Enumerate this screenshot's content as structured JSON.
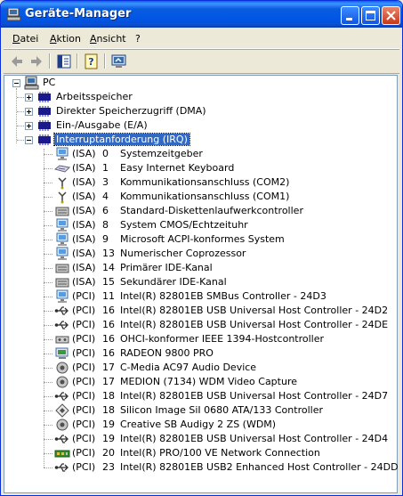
{
  "window": {
    "title": "Geräte-Manager"
  },
  "menu": [
    "Datei",
    "Aktion",
    "Ansicht",
    "?"
  ],
  "tree": {
    "root": "PC",
    "categories": [
      {
        "label": "Arbeitsspeicher",
        "expanded": false
      },
      {
        "label": "Direkter Speicherzugriff (DMA)",
        "expanded": false
      },
      {
        "label": "Ein-/Ausgabe (E/A)",
        "expanded": false
      },
      {
        "label": "Interruptanforderung (IRQ)",
        "expanded": true,
        "selected": true
      }
    ],
    "irq_items": [
      {
        "bus": "(ISA)",
        "irq": "0",
        "desc": "Systemzeitgeber",
        "icon": "monitor-icon"
      },
      {
        "bus": "(ISA)",
        "irq": "1",
        "desc": "Easy Internet Keyboard",
        "icon": "keyboard-icon"
      },
      {
        "bus": "(ISA)",
        "irq": "3",
        "desc": "Kommunikationsanschluss (COM2)",
        "icon": "port-icon"
      },
      {
        "bus": "(ISA)",
        "irq": "4",
        "desc": "Kommunikationsanschluss (COM1)",
        "icon": "port-icon"
      },
      {
        "bus": "(ISA)",
        "irq": "6",
        "desc": "Standard-Diskettenlaufwerkcontroller",
        "icon": "drive-controller-icon"
      },
      {
        "bus": "(ISA)",
        "irq": "8",
        "desc": "System CMOS/Echtzeituhr",
        "icon": "monitor-icon"
      },
      {
        "bus": "(ISA)",
        "irq": "9",
        "desc": "Microsoft ACPI-konformes System",
        "icon": "monitor-icon"
      },
      {
        "bus": "(ISA)",
        "irq": "13",
        "desc": "Numerischer Coprozessor",
        "icon": "monitor-icon"
      },
      {
        "bus": "(ISA)",
        "irq": "14",
        "desc": "Primärer IDE-Kanal",
        "icon": "drive-controller-icon"
      },
      {
        "bus": "(ISA)",
        "irq": "15",
        "desc": "Sekundärer IDE-Kanal",
        "icon": "drive-controller-icon"
      },
      {
        "bus": "(PCI)",
        "irq": "11",
        "desc": "Intel(R) 82801EB SMBus Controller - 24D3",
        "icon": "monitor-icon"
      },
      {
        "bus": "(PCI)",
        "irq": "16",
        "desc": "Intel(R) 82801EB USB Universal Host Controller - 24D2",
        "icon": "usb-icon"
      },
      {
        "bus": "(PCI)",
        "irq": "16",
        "desc": "Intel(R) 82801EB USB Universal Host Controller - 24DE",
        "icon": "usb-icon"
      },
      {
        "bus": "(PCI)",
        "irq": "16",
        "desc": "OHCI-konformer IEEE 1394-Hostcontroller",
        "icon": "firewire-icon"
      },
      {
        "bus": "(PCI)",
        "irq": "16",
        "desc": "RADEON 9800 PRO",
        "icon": "display-adapter-icon"
      },
      {
        "bus": "(PCI)",
        "irq": "17",
        "desc": "C-Media AC97 Audio Device",
        "icon": "speaker-icon"
      },
      {
        "bus": "(PCI)",
        "irq": "17",
        "desc": "MEDION (7134) WDM Video Capture",
        "icon": "speaker-icon"
      },
      {
        "bus": "(PCI)",
        "irq": "18",
        "desc": "Intel(R) 82801EB USB Universal Host Controller - 24D7",
        "icon": "usb-icon"
      },
      {
        "bus": "(PCI)",
        "irq": "18",
        "desc": "Silicon Image SiI 0680 ATA/133 Controller",
        "icon": "scsi-icon"
      },
      {
        "bus": "(PCI)",
        "irq": "19",
        "desc": "Creative SB Audigy 2 ZS (WDM)",
        "icon": "speaker-icon"
      },
      {
        "bus": "(PCI)",
        "irq": "19",
        "desc": "Intel(R) 82801EB USB Universal Host Controller - 24D4",
        "icon": "usb-icon"
      },
      {
        "bus": "(PCI)",
        "irq": "20",
        "desc": "Intel(R) PRO/100 VE Network Connection",
        "icon": "network-card-icon"
      },
      {
        "bus": "(PCI)",
        "irq": "23",
        "desc": "Intel(R) 82801EB USB2 Enhanced Host Controller - 24DD",
        "icon": "usb-icon"
      }
    ]
  },
  "colors": {
    "titlebar": "#0055e5",
    "selection": "#316ac5",
    "close_button": "#c4391d"
  }
}
